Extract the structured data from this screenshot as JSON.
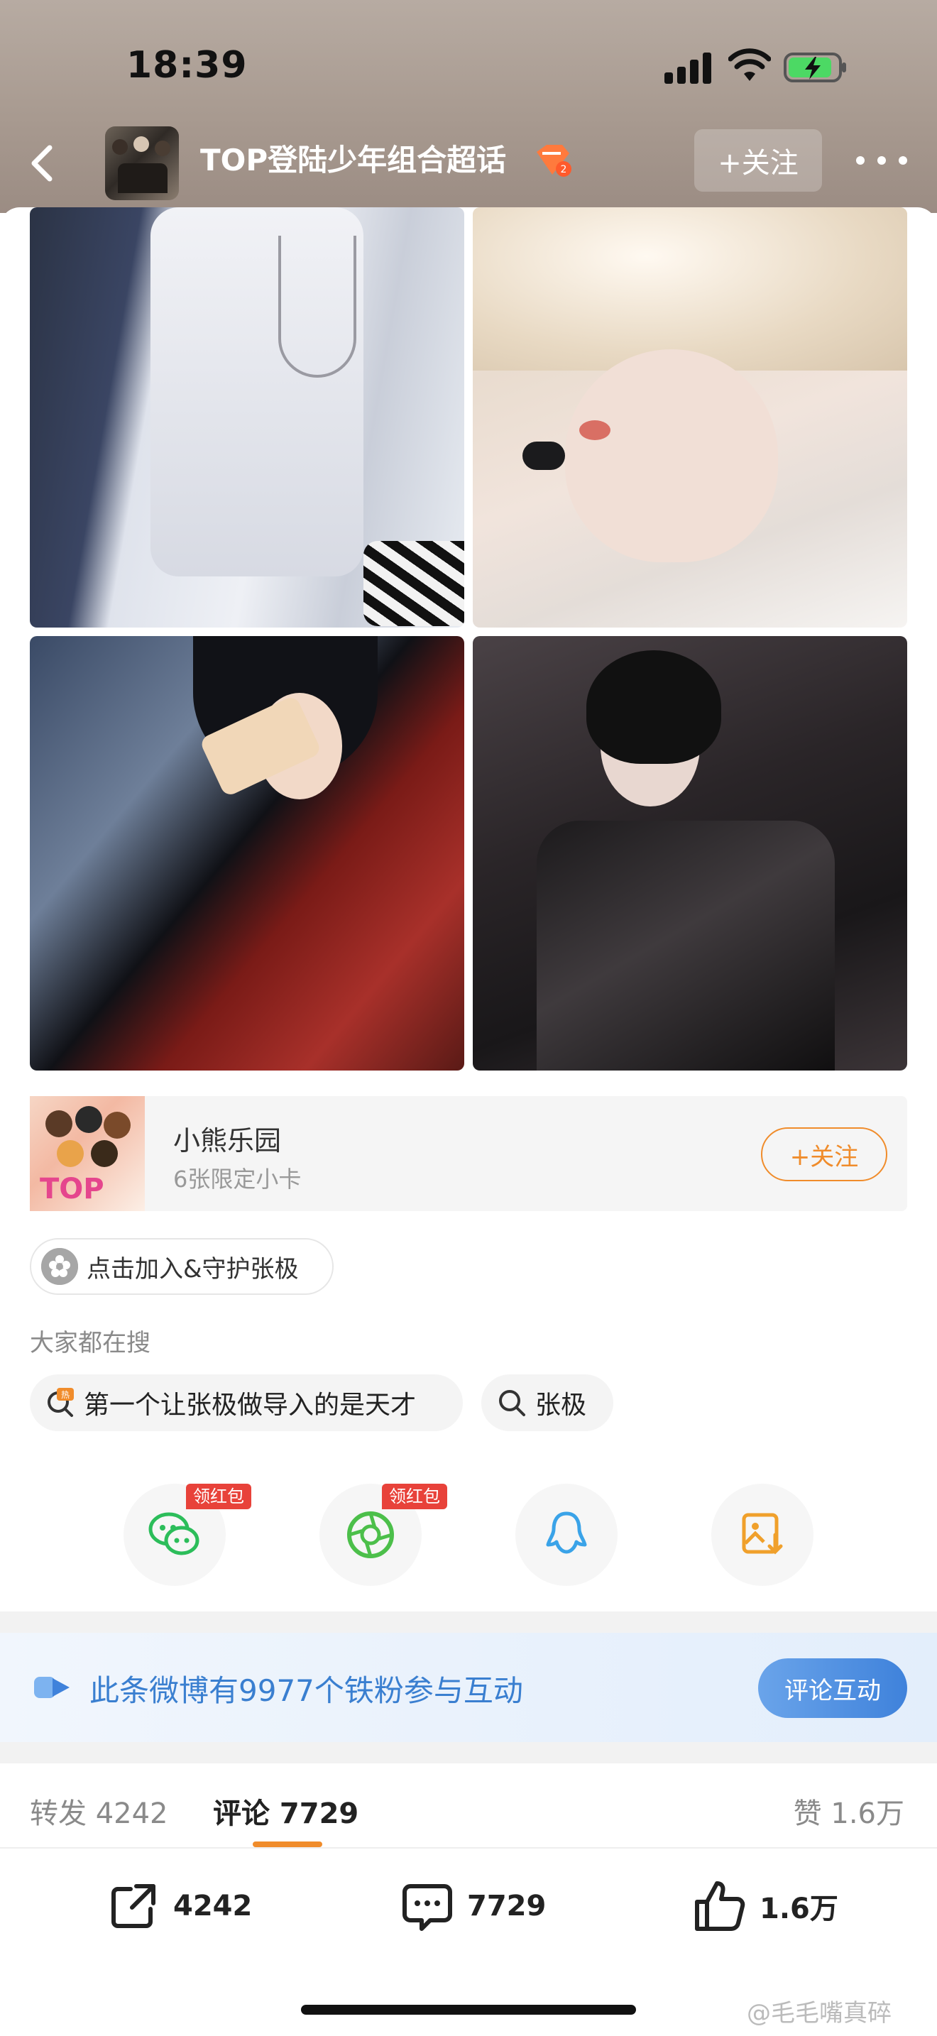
{
  "status_bar": {
    "time": "18:39"
  },
  "nav": {
    "title": "TOP登陆少年组合超话",
    "follow_label": "+关注"
  },
  "post": {
    "image_count": 4
  },
  "promo": {
    "title": "小熊乐园",
    "subtitle": "6张限定小卡",
    "thumb_text": "TOP",
    "follow_label": "+关注"
  },
  "topic_chip": {
    "label": "点击加入&守护张极"
  },
  "search": {
    "label": "大家都在搜",
    "items": [
      {
        "text": "第一个让张极做导入的是天才",
        "icon": "hot-search-icon"
      },
      {
        "text": "张极",
        "icon": "search-icon"
      }
    ]
  },
  "share": {
    "red_tag": "领红包",
    "targets": [
      "wechat-icon",
      "moments-icon",
      "qq-icon",
      "save-image-icon"
    ]
  },
  "fan_banner": {
    "text": "此条微博有9977个铁粉参与互动",
    "button": "评论互动"
  },
  "tabs": {
    "repost": "转发 4242",
    "comment": "评论 7729",
    "like": "赞 1.6万"
  },
  "bottom_bar": {
    "repost_count": "4242",
    "comment_count": "7729",
    "like_count": "1.6万"
  },
  "watermark": "@毛毛嘴真碎",
  "colors": {
    "accent": "#f08c2b",
    "link_blue": "#3a7fd0",
    "red_tag": "#e8423a"
  }
}
